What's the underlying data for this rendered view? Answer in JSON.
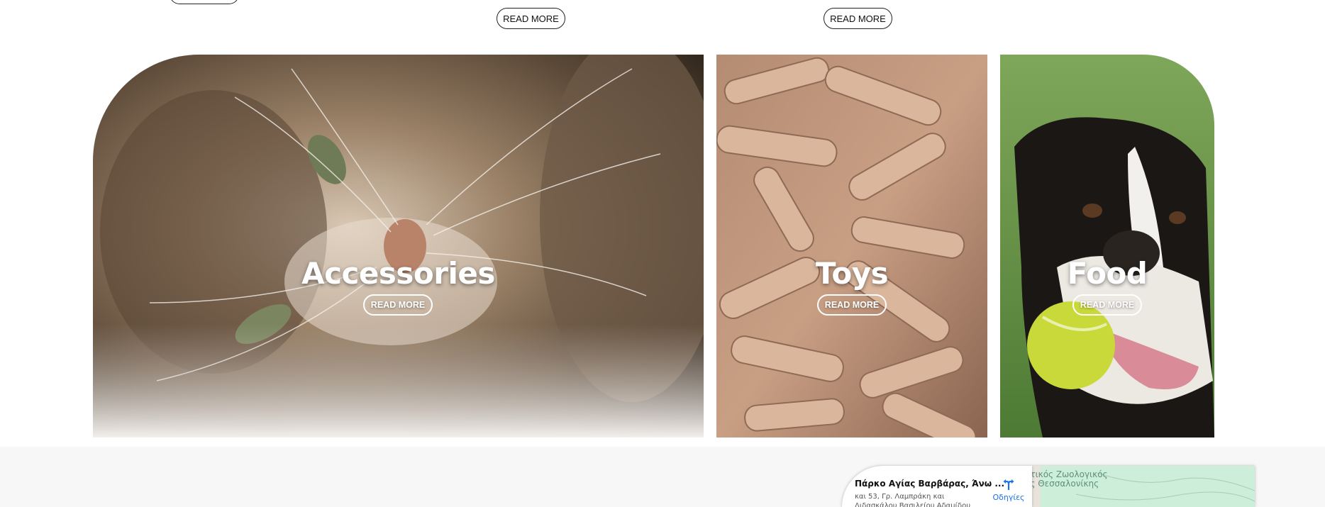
{
  "top_row": {
    "read_more_1": "READ MORE",
    "read_more_2": "READ MORE"
  },
  "categories": [
    {
      "title": "Accessories",
      "button": "READ MORE",
      "image": "tabby cat lying on side"
    },
    {
      "title": "Toys",
      "button": "READ MORE",
      "image": "bone-shaped dog biscuits"
    },
    {
      "title": "Food",
      "button": "READ MORE",
      "image": "boxer dog with tennis ball"
    }
  ],
  "map": {
    "place_title": "Πάρκο Αγίας Βαρβάρας, Άνω ...",
    "address_line1": "και 53, Γρ. Λαμπράκη και",
    "address_line2": "Διδασκάλου Βασιλείου Αδαμίδου",
    "directions_label": "Οδηγίες",
    "poi_line1": "οτικός Ζωολογικός",
    "poi_line2": "ος Θεσσαλονίκης"
  },
  "colors": {
    "button_border": "#222222",
    "footer_bg": "#f7f7f7",
    "map_link": "#1a73e8"
  }
}
